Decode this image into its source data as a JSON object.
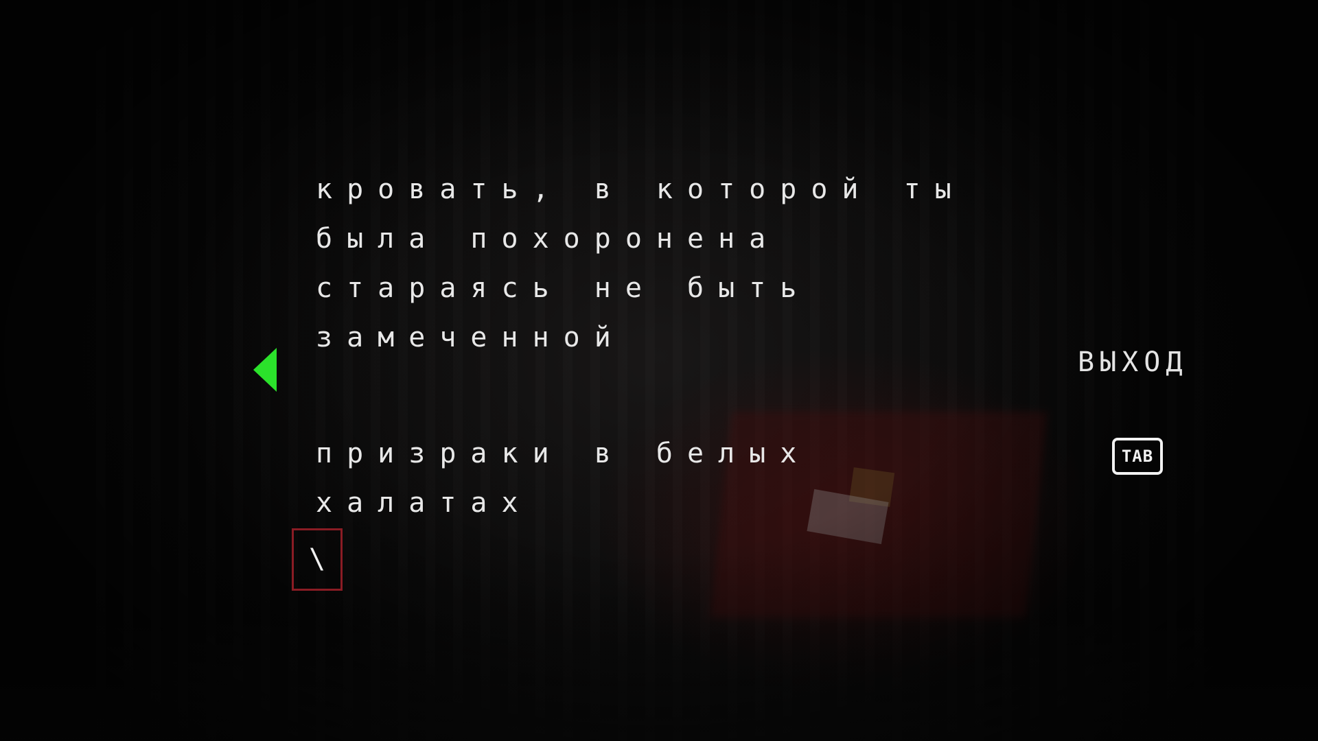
{
  "text_lines": {
    "block1": [
      "кровать, в которой ты",
      "была похоронена",
      "стараясь не быть",
      "замеченной"
    ],
    "block2": [
      "призраки в белых",
      "халатах"
    ]
  },
  "buttons": {
    "exit_label": "ВЫХОД",
    "tab_key_label": "TAB"
  },
  "input": {
    "current_value": "\\"
  },
  "icons": {
    "nav_arrow": "left-triangle-icon"
  },
  "colors": {
    "text": "#e8e8e8",
    "arrow_accent": "#2be22b",
    "input_border": "#8a1c24",
    "background": "#050505"
  }
}
